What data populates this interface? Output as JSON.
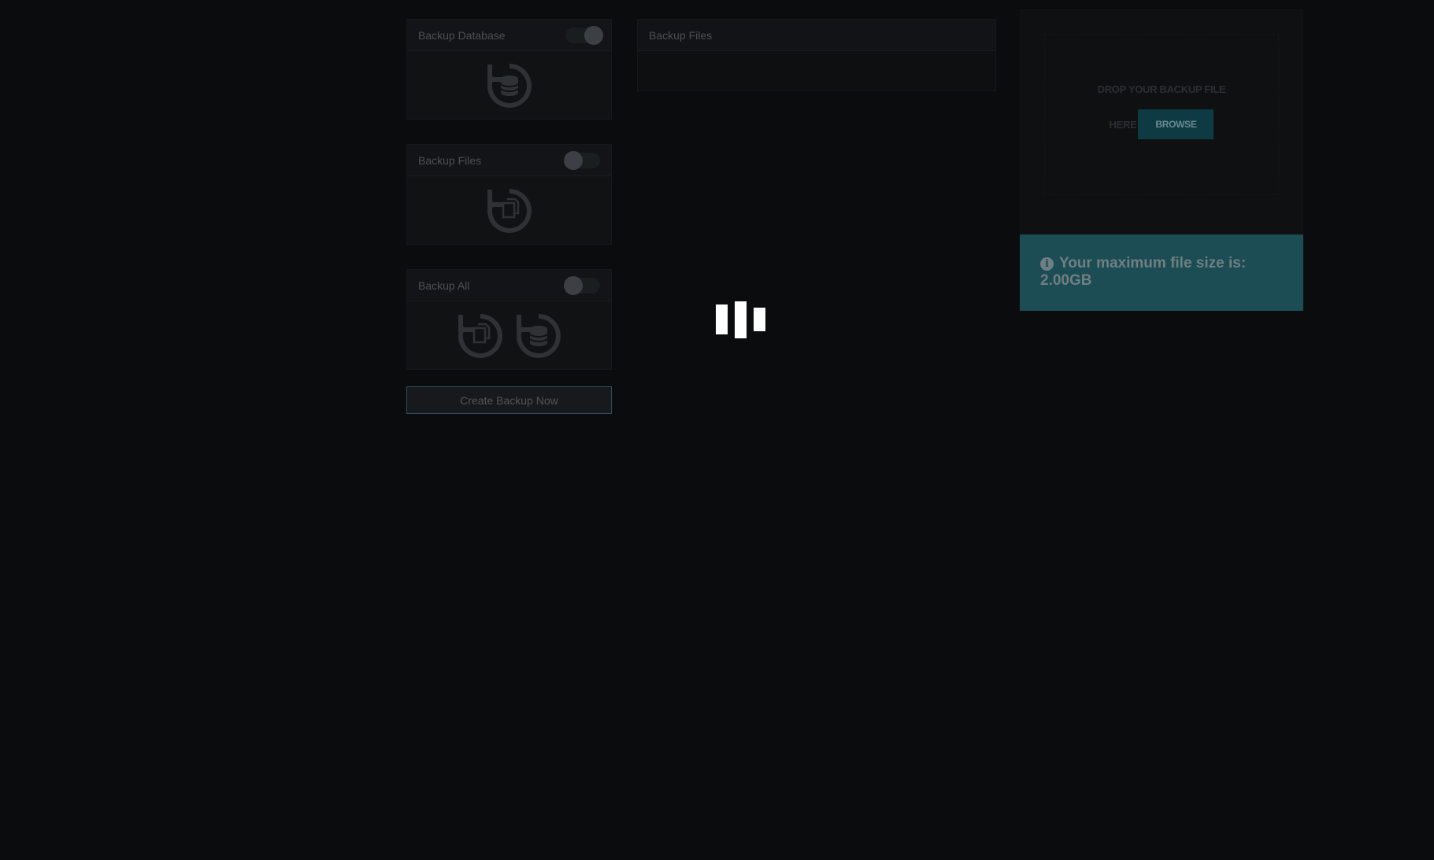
{
  "backup_options": [
    {
      "title": "Backup Database",
      "enabled": true,
      "icons": [
        "restore-database-icon"
      ]
    },
    {
      "title": "Backup Files",
      "enabled": false,
      "icons": [
        "restore-files-icon"
      ]
    },
    {
      "title": "Backup All",
      "enabled": false,
      "icons": [
        "restore-files-icon",
        "restore-database-icon"
      ]
    }
  ],
  "create_button": {
    "label": "Create Backup Now"
  },
  "files_panel": {
    "title": "Backup Files"
  },
  "upload": {
    "drop_text": "DROP YOUR BACKUP FILE",
    "here_text": "HERE",
    "browse_label": "BROWSE"
  },
  "info": {
    "icon": "info-icon",
    "message": "Your maximum file size is: 2.00GB"
  },
  "loader": {
    "icon": "loading-bars-icon"
  },
  "colors": {
    "background": "#0a0c0e",
    "info_box": "#1c4d54",
    "browse_button": "#0e3a44",
    "button_border": "#2e4d66"
  }
}
